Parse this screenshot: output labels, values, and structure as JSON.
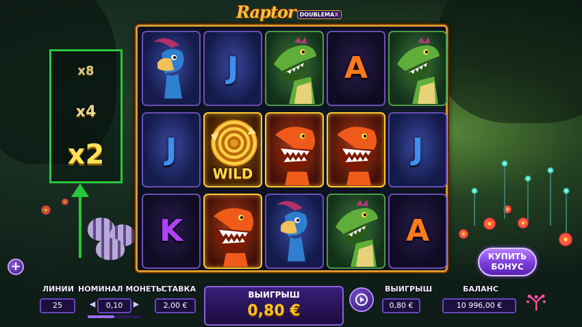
{
  "logo": {
    "main": "Raptor",
    "sub_prefix": "DOUBLEMA",
    "sub_suffix": "X"
  },
  "multipliers": [
    "x8",
    "x4",
    "x2"
  ],
  "reels": [
    [
      "parasaurolophus",
      "J",
      "K"
    ],
    [
      "J",
      "wild",
      "trex"
    ],
    [
      "raptor",
      "trex",
      "parasaurolophus"
    ],
    [
      "A",
      "trex",
      "raptor"
    ],
    [
      "raptor",
      "J",
      "A"
    ]
  ],
  "wild_label": "WILD",
  "buy_bonus": {
    "line1": "КУПИТЬ",
    "line2": "БОНУС"
  },
  "controls": {
    "lines_label": "ЛИНИИ",
    "lines_value": "25",
    "coin_label": "НОМИНАЛ МОНЕТЫ",
    "coin_value": "0,10",
    "coin_level": 0.5,
    "bet_label": "СТАВКА",
    "bet_value": "2,00 €",
    "win_main_label": "ВЫИГРЫШ",
    "win_main_value": "0,80 €",
    "win_label": "ВЫИГРЫШ",
    "win_value": "0,80 €",
    "balance_label": "БАЛАНС",
    "balance_value": "10 996,00 €"
  },
  "colors": {
    "accent_green": "#27c93a",
    "reel_frame": "#d99a2b",
    "win_value": "#ffc21a",
    "button_purple": "#7a3cd8"
  },
  "icons": [
    "plus-icon",
    "spin-icon",
    "yggdrasil-logo-icon"
  ]
}
